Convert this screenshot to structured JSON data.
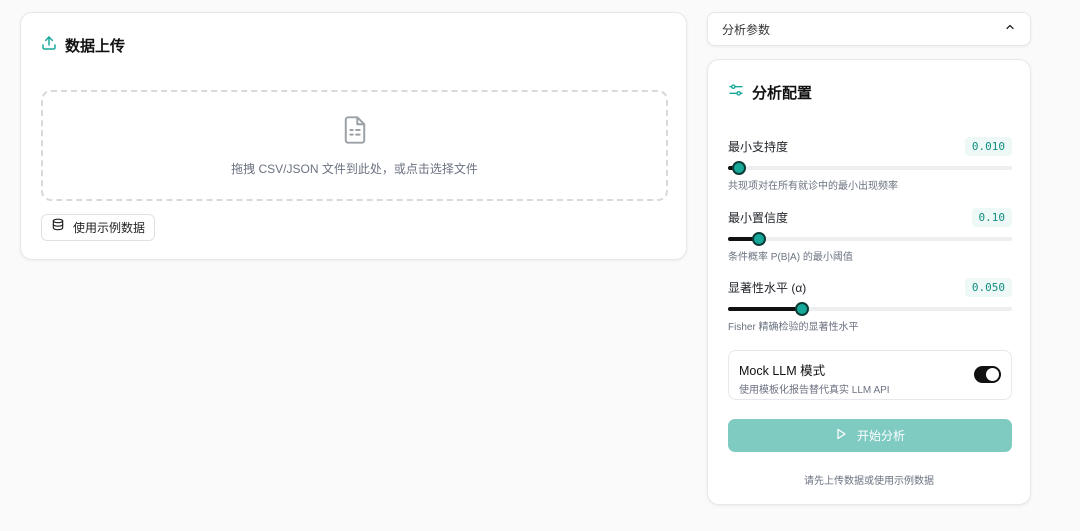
{
  "colors": {
    "accent": "#16a99a",
    "accent_disabled": "#7fcac1",
    "value_text": "#0f8f80",
    "value_bg": "#eef8f6",
    "slider_fill": "#111111"
  },
  "upload": {
    "title": "数据上传",
    "title_icon": "upload-icon",
    "dropzone_icon": "file-spreadsheet-icon",
    "dropzone_text": "拖拽 CSV/JSON 文件到此处，或点击选择文件",
    "sample_button_icon": "database-icon",
    "sample_button_label": "使用示例数据"
  },
  "params_panel": {
    "label": "分析参数",
    "chevron_icon": "chevron-up-icon"
  },
  "config": {
    "title": "分析配置",
    "title_icon": "sliders-icon",
    "params": [
      {
        "name": "最小支持度",
        "value": "0.010",
        "fraction": 0.04,
        "desc": "共现项对在所有就诊中的最小出现频率"
      },
      {
        "name": "最小置信度",
        "value": "0.10",
        "fraction": 0.11,
        "desc": "条件概率 P(B|A) 的最小阈值"
      },
      {
        "name": "显著性水平 (α)",
        "value": "0.050",
        "fraction": 0.26,
        "desc": "Fisher 精确检验的显著性水平"
      }
    ],
    "mock": {
      "title": "Mock LLM 模式",
      "subtitle": "使用模板化报告替代真实 LLM API",
      "enabled": true
    },
    "start_button_icon": "play-icon",
    "start_button_label": "开始分析",
    "hint": "请先上传数据或使用示例数据"
  }
}
